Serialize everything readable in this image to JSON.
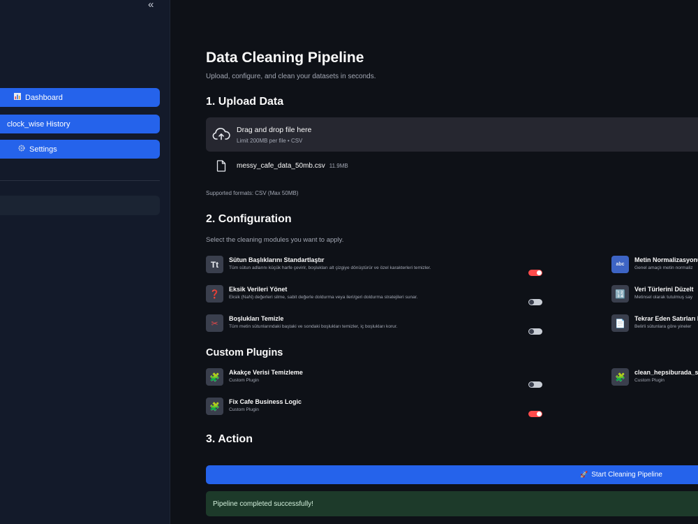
{
  "sidebar": {
    "collapse_label": "«",
    "nav": [
      {
        "label": "Dashboard",
        "icon": "bar-chart-icon"
      },
      {
        "label": "clock_wise History",
        "icon": ""
      },
      {
        "label": "Settings",
        "icon": "gear-icon"
      }
    ]
  },
  "main": {
    "title": "Data Cleaning Pipeline",
    "subtitle": "Upload, configure, and clean your datasets in seconds.",
    "upload": {
      "heading": "1. Upload Data",
      "dropzone_title": "Drag and drop file here",
      "dropzone_limit": "Limit 200MB per file • CSV",
      "file_name": "messy_cafe_data_50mb.csv",
      "file_size": "11.9MB",
      "supported": "Supported formats: CSV (Max 50MB)"
    },
    "config": {
      "heading": "2. Configuration",
      "subtitle": "Select the cleaning modules you want to apply.",
      "modules_left": [
        {
          "icon": "Tt",
          "title": "Sütun Başlıklarını Standartlaştır",
          "desc": "Tüm sütun adlarını küçük harfe çevirir, boşlukları alt çizgiye dönüştürür ve özel karakterleri temizler.",
          "enabled": true
        },
        {
          "icon": "❓",
          "title": "Eksik Verileri Yönet",
          "desc": "Eksik (NaN) değerleri silme, sabit değerle doldurma veya ileri/geri doldurma stratejileri sunar.",
          "enabled": false
        },
        {
          "icon": "✂",
          "title": "Boşlukları Temizle",
          "desc": "Tüm metin sütunlarındaki baştaki ve sondaki boşlukları temizler, iç boşlukları korur.",
          "enabled": false
        }
      ],
      "modules_right": [
        {
          "icon": "abc",
          "title": "Metin Normalizasyonu",
          "desc": "Genel amaçlı metin normaliz"
        },
        {
          "icon": "🔢",
          "title": "Veri Türlerini Düzelt",
          "desc": "Metinsel olarak tutulmuş say"
        },
        {
          "icon": "📄",
          "title": "Tekrar Eden Satırları K",
          "desc": "Belirli sütunlara göre yineler"
        }
      ]
    },
    "plugins": {
      "heading": "Custom Plugins",
      "left": [
        {
          "icon": "🧩",
          "title": "Akakçe Verisi Temizleme",
          "desc": "Custom Plugin",
          "enabled": false
        },
        {
          "icon": "🧩",
          "title": "Fix Cafe Business Logic",
          "desc": "Custom Plugin",
          "enabled": true
        }
      ],
      "right": [
        {
          "icon": "🧩",
          "title": "clean_hepsiburada_sc",
          "desc": "Custom Plugin"
        }
      ]
    },
    "action": {
      "heading": "3. Action",
      "start_label": "Start Cleaning Pipeline",
      "start_icon": "🚀",
      "success_message": "Pipeline completed successfully!"
    }
  }
}
